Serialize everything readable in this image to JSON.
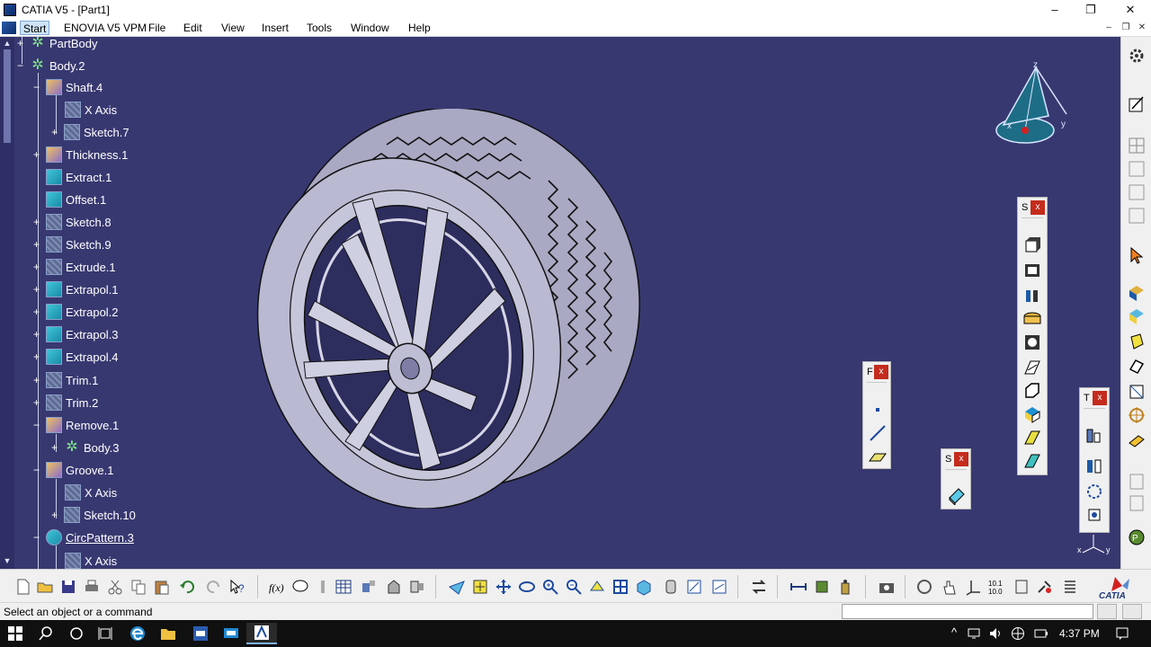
{
  "window": {
    "title": "CATIA V5 - [Part1]",
    "controls": {
      "minimize": "–",
      "maximize": "❐",
      "close": "✕"
    },
    "mdi_controls": {
      "minimize": "–",
      "restore": "❐",
      "close": "✕"
    }
  },
  "menu": {
    "items": [
      {
        "label": "Start",
        "active": true
      },
      {
        "label": "ENOVIA V5 VPM"
      },
      {
        "label": "File"
      },
      {
        "label": "Edit"
      },
      {
        "label": "View"
      },
      {
        "label": "Insert"
      },
      {
        "label": "Tools"
      },
      {
        "label": "Window"
      },
      {
        "label": "Help"
      }
    ]
  },
  "tree": {
    "items": [
      {
        "label": "PartBody",
        "icon": "body-icon"
      },
      {
        "label": "Body.2",
        "icon": "body-icon"
      },
      {
        "label": "Shaft.4",
        "icon": "shaft-icon"
      },
      {
        "label": "X Axis",
        "icon": "axis-icon"
      },
      {
        "label": "Sketch.7",
        "icon": "sketch-icon"
      },
      {
        "label": "Thickness.1",
        "icon": "thickness-icon"
      },
      {
        "label": "Extract.1",
        "icon": "extract-icon"
      },
      {
        "label": "Offset.1",
        "icon": "offset-icon"
      },
      {
        "label": "Sketch.8",
        "icon": "sketch-icon"
      },
      {
        "label": "Sketch.9",
        "icon": "sketch-icon"
      },
      {
        "label": "Extrude.1",
        "icon": "extrude-icon"
      },
      {
        "label": "Extrapol.1",
        "icon": "extrapol-icon"
      },
      {
        "label": "Extrapol.2",
        "icon": "extrapol-icon"
      },
      {
        "label": "Extrapol.3",
        "icon": "extrapol-icon"
      },
      {
        "label": "Extrapol.4",
        "icon": "extrapol-icon"
      },
      {
        "label": "Trim.1",
        "icon": "trim-icon"
      },
      {
        "label": "Trim.2",
        "icon": "trim-icon"
      },
      {
        "label": "Remove.1",
        "icon": "remove-icon"
      },
      {
        "label": "Body.3",
        "icon": "body-icon"
      },
      {
        "label": "Groove.1",
        "icon": "groove-icon"
      },
      {
        "label": "X Axis",
        "icon": "axis-icon"
      },
      {
        "label": "Sketch.10",
        "icon": "sketch-icon"
      },
      {
        "label": "CircPattern.3",
        "icon": "circpattern-icon"
      },
      {
        "label": "X Axis",
        "icon": "axis-icon"
      }
    ]
  },
  "compass": {
    "x": "x",
    "y": "y",
    "z": "z"
  },
  "mini_axis": {
    "x": "x",
    "y": "y"
  },
  "floating_toolbars": {
    "sketch_based": {
      "title": "S",
      "close": "x"
    },
    "reference": {
      "title": "F",
      "close": "x"
    },
    "surface": {
      "title": "S",
      "close": "x"
    },
    "transform": {
      "title": "T",
      "close": "x"
    }
  },
  "status": {
    "message": "Select an object or a command",
    "command_input": ""
  },
  "brand": {
    "logo_text": "CATIA"
  },
  "taskbar": {
    "time": "4:37 PM"
  },
  "colors": {
    "viewport_bg": "#383871",
    "tree_text": "#ffffff",
    "close_red": "#c42b1c",
    "tire_fill": "#b7b7ce"
  }
}
